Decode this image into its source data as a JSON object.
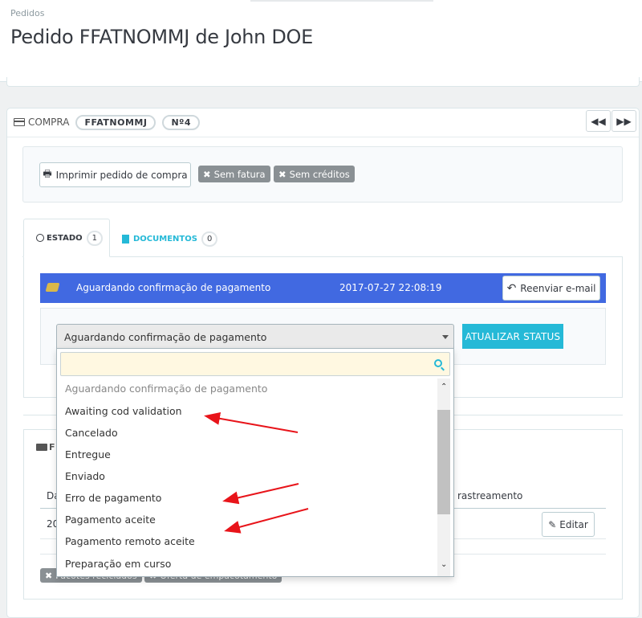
{
  "breadcrumb": "Pedidos",
  "page_title": "Pedido FFATNOMMJ de John DOE",
  "order": {
    "section_label": "COMPRA",
    "reference": "FFATNOMMJ",
    "number": "Nº4"
  },
  "actions": {
    "print": "Imprimir pedido de compra",
    "no_invoice": "Sem fatura",
    "no_credits": "Sem créditos"
  },
  "tabs": [
    {
      "label": "ESTADO",
      "count": "1"
    },
    {
      "label": "DOCUMENTOS",
      "count": "0"
    }
  ],
  "status": {
    "current": "Aguardando confirmação de pagamento",
    "date": "2017-07-27 22:08:19",
    "resend_label": "Reenviar e-mail",
    "color": "#4169e1"
  },
  "status_select": {
    "value": "Aguardando confirmação de pagamento",
    "update_label": "ATUALIZAR STATUS",
    "search_value": ""
  },
  "dropdown_options": [
    "Aguardando confirmação de pagamento",
    "Awaiting cod validation",
    "Cancelado",
    "Entregue",
    "Enviado",
    "Erro de pagamento",
    "Pagamento aceite",
    "Pagamento remoto aceite",
    "Preparação em curso"
  ],
  "shipping": {
    "header_prefix": "F",
    "col_date_prefix": "Da",
    "col_tracking": "rastreamento",
    "row_date_prefix": "20",
    "edit_label": "Editar",
    "tag1": "Pacotes reciclados",
    "tag2": "Oferta de empacotamento"
  },
  "colors": {
    "accent": "#25b9d7",
    "status_bg": "#4169e1",
    "arrow": "#e8141a"
  }
}
